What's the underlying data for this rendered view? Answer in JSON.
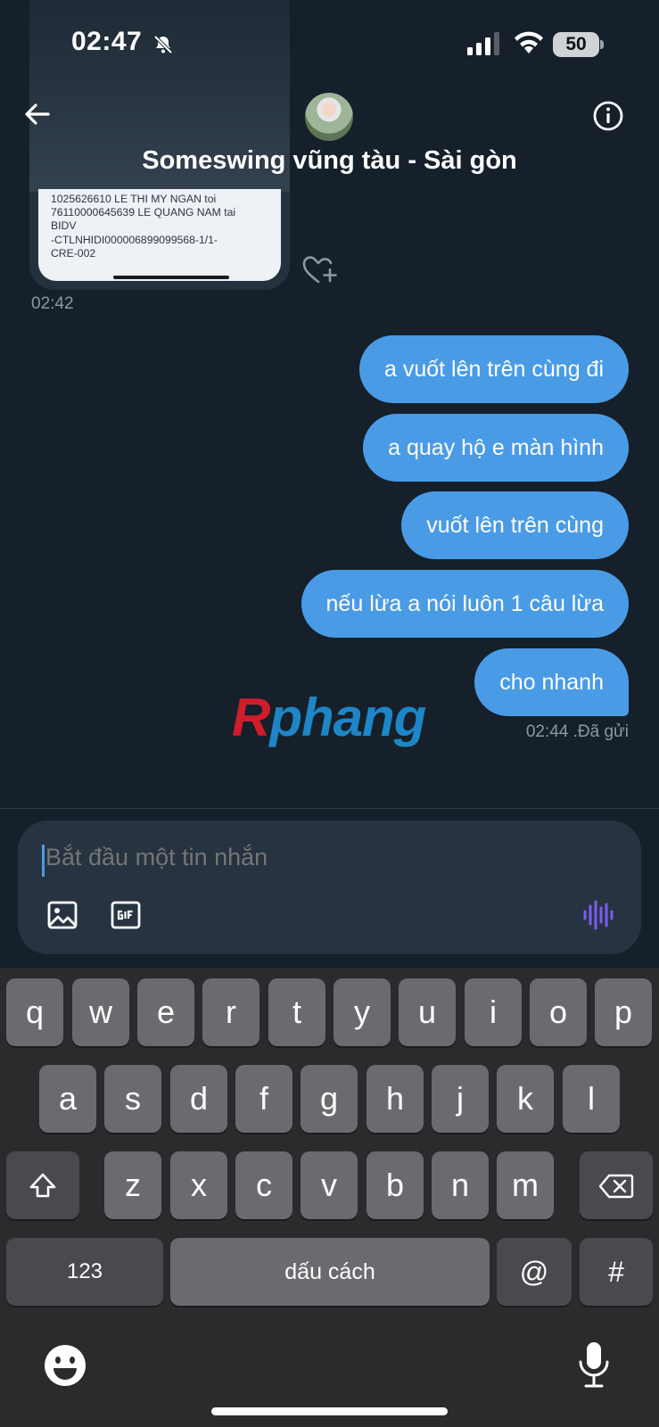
{
  "status_bar": {
    "time": "02:47",
    "battery": "50"
  },
  "header": {
    "title": "Someswing vũng tàu - Sài gòn"
  },
  "messages": {
    "image_text": "1025626610 LE THI MY NGAN toi\n76110000645639 LE QUANG NAM tai\nBIDV\n-CTLNHIDI000006899099568-1/1-\nCRE-002",
    "image_time": "02:42",
    "outgoing": [
      "a vuốt lên trên cùng đi",
      "a quay hộ e màn hình",
      "vuốt lên trên cùng",
      "nếu lừa a nói luôn 1 câu lừa",
      "cho nhanh"
    ],
    "sent_time": "02:44",
    "sent_status": ".Đã gửi"
  },
  "watermark": {
    "part1": "R",
    "part2": "phang"
  },
  "composer": {
    "placeholder": "Bắt đầu một tin nhắn"
  },
  "keyboard": {
    "row1": [
      "q",
      "w",
      "e",
      "r",
      "t",
      "y",
      "u",
      "i",
      "o",
      "p"
    ],
    "row2": [
      "a",
      "s",
      "d",
      "f",
      "g",
      "h",
      "j",
      "k",
      "l"
    ],
    "row3": [
      "z",
      "x",
      "c",
      "v",
      "b",
      "n",
      "m"
    ],
    "numbers_key": "123",
    "space_key": "dấu cách",
    "at_key": "@",
    "hash_key": "#"
  },
  "colors": {
    "background": "#15202b",
    "bubble": "#4a9be6",
    "muted_text": "#8b98a5",
    "voice_accent": "#7b5cf0"
  }
}
